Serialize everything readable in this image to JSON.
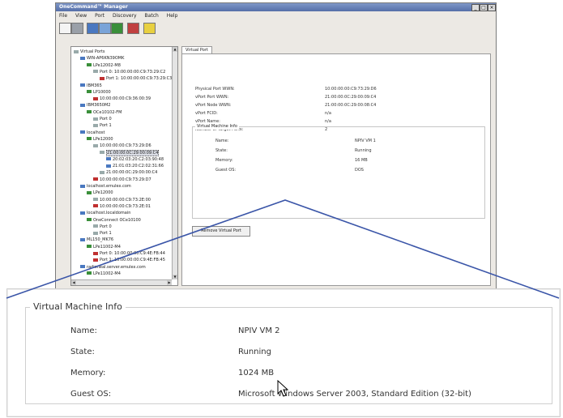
{
  "window": {
    "title": "OneCommand™ Manager",
    "menu": [
      "File",
      "View",
      "Port",
      "Discovery",
      "Batch",
      "Help"
    ]
  },
  "toolbar_icons": [
    "discovery-icon",
    "host-view-icon",
    "fabric-view-icon",
    "vport-view-icon",
    "batch-icon",
    "find-icon",
    "help-icon"
  ],
  "tree": {
    "items": [
      {
        "text": "Virtual Ports",
        "indent": 0,
        "icon": "c"
      },
      {
        "text": "WIN-AP6KN39OMK",
        "indent": 1,
        "icon": "b"
      },
      {
        "text": "LPe12002-M8",
        "indent": 2,
        "icon": "g"
      },
      {
        "text": "Port 0: 10:00:00:00:C9:73:29:C2",
        "indent": 3,
        "icon": "c"
      },
      {
        "text": "Port 1: 10:00:00:00:C9:73:29:C3",
        "indent": 4,
        "icon": "r"
      },
      {
        "text": "IBM365",
        "indent": 1,
        "icon": "b"
      },
      {
        "text": "LP10000",
        "indent": 2,
        "icon": "g"
      },
      {
        "text": "10:00:00:00:C9:36:00:39",
        "indent": 3,
        "icon": "r"
      },
      {
        "text": "IBM3650M2",
        "indent": 1,
        "icon": "b"
      },
      {
        "text": "OCe10102-FM",
        "indent": 2,
        "icon": "g"
      },
      {
        "text": "Port 0",
        "indent": 3,
        "icon": "c"
      },
      {
        "text": "Port 1",
        "indent": 3,
        "icon": "c"
      },
      {
        "text": "localhost",
        "indent": 1,
        "icon": "b"
      },
      {
        "text": "LPe12000",
        "indent": 2,
        "icon": "g"
      },
      {
        "text": "10:00:00:00:C9:73:29:D6",
        "indent": 3,
        "icon": "c"
      },
      {
        "text": "21:00:00:0C:29:00:09:C4",
        "indent": 4,
        "icon": "c",
        "selected": true
      },
      {
        "text": "20:02:03:20:C2:03:90:48",
        "indent": 5,
        "icon": "b"
      },
      {
        "text": "21:01:03:20:C2:02:31:66",
        "indent": 5,
        "icon": "b"
      },
      {
        "text": "21:00:00:0C:29:00:00:C4",
        "indent": 4,
        "icon": "c"
      },
      {
        "text": "10:00:00:00:C9:73:29:D7",
        "indent": 3,
        "icon": "r"
      },
      {
        "text": "localhost.emulex.com",
        "indent": 1,
        "icon": "b"
      },
      {
        "text": "LPe12000",
        "indent": 2,
        "icon": "g"
      },
      {
        "text": "10:00:00:00:C9:73:2E:00",
        "indent": 3,
        "icon": "c"
      },
      {
        "text": "10:00:00:00:C9:73:2E:01",
        "indent": 3,
        "icon": "r"
      },
      {
        "text": "localhost.localdomain",
        "indent": 1,
        "icon": "b"
      },
      {
        "text": "OneConnect OCe10100",
        "indent": 2,
        "icon": "g"
      },
      {
        "text": "Port 0",
        "indent": 3,
        "icon": "c"
      },
      {
        "text": "Port 1",
        "indent": 3,
        "icon": "c"
      },
      {
        "text": "ML150_MK76",
        "indent": 1,
        "icon": "b"
      },
      {
        "text": "LPe11002-M4",
        "indent": 2,
        "icon": "g"
      },
      {
        "text": "Port 0: 10:00:00:00:C9:4E:FB:44",
        "indent": 3,
        "icon": "r"
      },
      {
        "text": "Port 1: 10:00:00:00:C9:4E:FB:45",
        "indent": 3,
        "icon": "r"
      },
      {
        "text": "radioneal.server.emulex.com",
        "indent": 1,
        "icon": "b"
      },
      {
        "text": "LPe11002-M4",
        "indent": 2,
        "icon": "g"
      }
    ]
  },
  "detail": {
    "tab_label": "Virtual Port",
    "fields": [
      {
        "label": "Physical Port WWN:",
        "value": "10:00:00:00:C9:73:29:D6"
      },
      {
        "label": "vPort Port WWN:",
        "value": "21:00:00:0C:29:00:09:C4"
      },
      {
        "label": "vPort Node WWN:",
        "value": "21:00:00:0C:29:00:08:C4"
      },
      {
        "label": "vPort FCID:",
        "value": "n/a"
      },
      {
        "label": "vPort Name:",
        "value": "n/a"
      },
      {
        "label": "Number of Target Ports:",
        "value": "2"
      }
    ],
    "vm_info": {
      "title": "Virtual Machine Info",
      "rows": [
        {
          "label": "Name:",
          "value": "NPIV VM 1"
        },
        {
          "label": "State:",
          "value": "Running"
        },
        {
          "label": "Memory:",
          "value": "16 MB"
        },
        {
          "label": "Guest OS:",
          "value": "DOS"
        }
      ]
    },
    "remove_button": "Remove Virtual Port"
  },
  "inset": {
    "title": "Virtual Machine Info",
    "rows": [
      {
        "label": "Name:",
        "value": "NPIV VM 2"
      },
      {
        "label": "State:",
        "value": "Running"
      },
      {
        "label": "Memory:",
        "value": "1024 MB"
      },
      {
        "label": "Guest OS:",
        "value": "Microsoft Windows Server 2003, Standard Edition (32-bit)"
      }
    ]
  },
  "colors": {
    "selection": "#d9dce4",
    "zoom_line": "#3a55a8",
    "title_bar": "#556fa8"
  }
}
